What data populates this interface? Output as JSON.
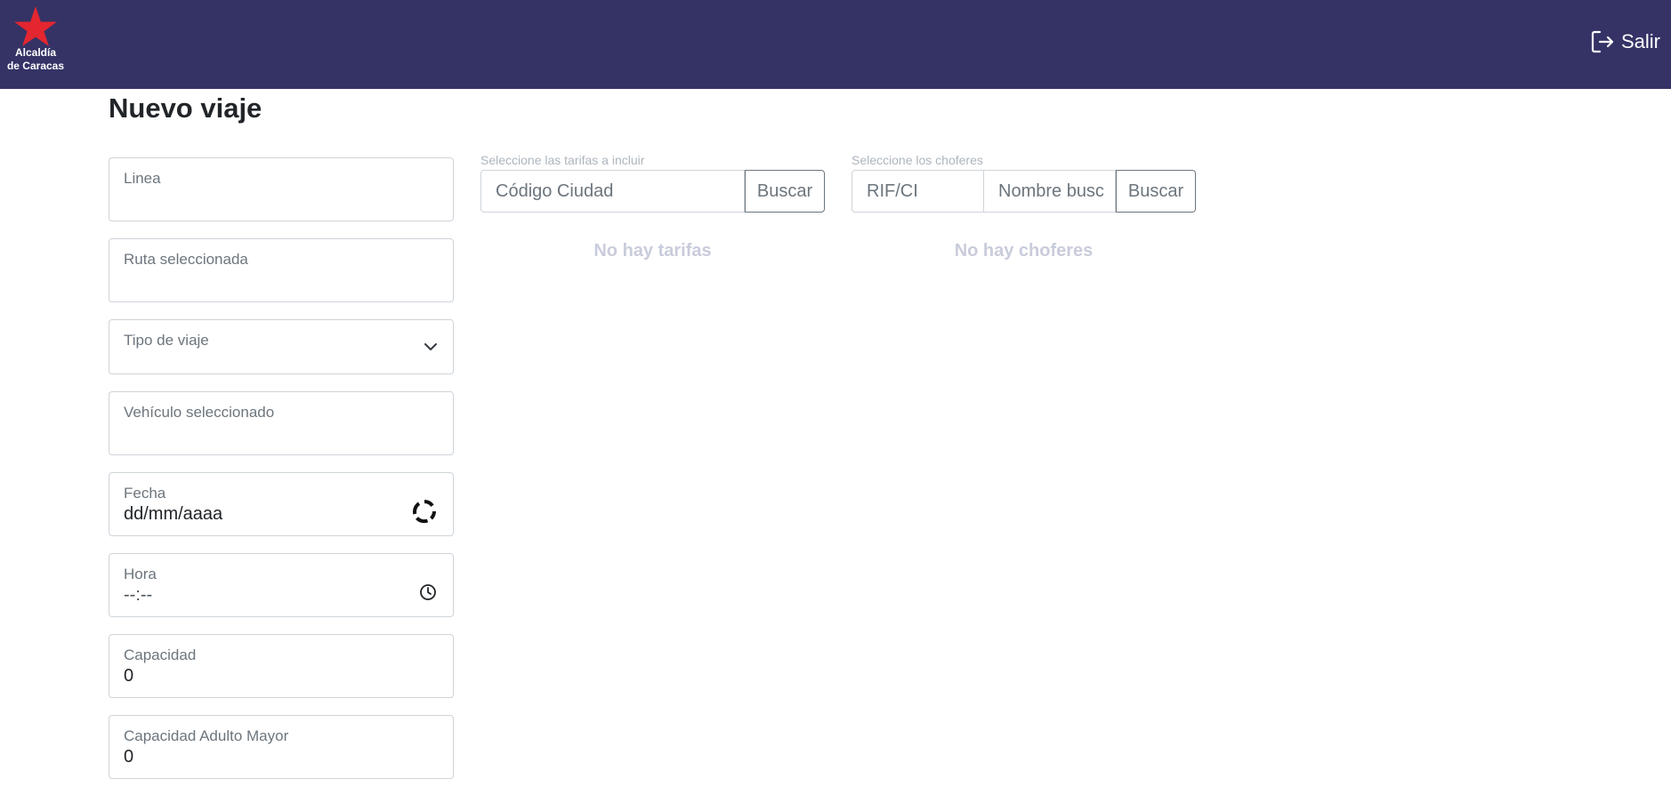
{
  "header": {
    "logo_line1": "Alcaldía",
    "logo_line2": "de Caracas",
    "logout_label": "Salir",
    "bg_color": "#353366",
    "logo_star_color": "#e3262f"
  },
  "page": {
    "title": "Nuevo viaje"
  },
  "form": {
    "linea": {
      "label": "Linea",
      "value": ""
    },
    "ruta": {
      "label": "Ruta seleccionada",
      "value": ""
    },
    "tipo": {
      "label": "Tipo de viaje",
      "value": ""
    },
    "vehiculo": {
      "label": "Vehículo seleccionado",
      "value": ""
    },
    "fecha": {
      "label": "Fecha",
      "value": "dd/mm/aaaa"
    },
    "hora": {
      "label": "Hora",
      "value": "--:--"
    },
    "capacidad": {
      "label": "Capacidad",
      "value": "0"
    },
    "capacidad_adulto": {
      "label": "Capacidad Adulto Mayor",
      "value": "0"
    }
  },
  "tarifas": {
    "caption": "Seleccione las tarifas a incluir",
    "input_placeholder": "Código Ciudad",
    "button_label": "Buscar",
    "empty_text": "No hay tarifas"
  },
  "choferes": {
    "caption": "Seleccione los choferes",
    "input1_placeholder": "RIF/CI",
    "input2_placeholder": "Nombre busc",
    "button_label": "Buscar",
    "empty_text": "No hay choferes"
  }
}
